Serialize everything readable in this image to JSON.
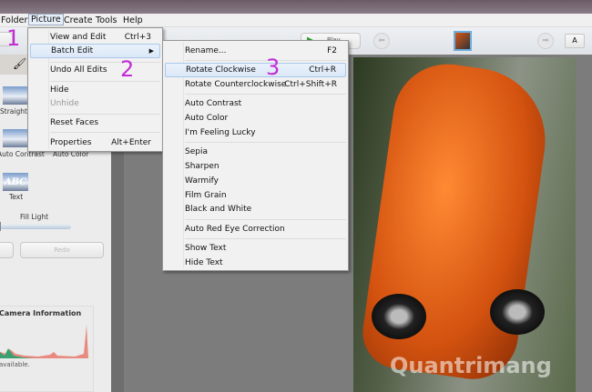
{
  "menubar": {
    "items": [
      "Folder",
      "Picture",
      "Create",
      "Tools",
      "Help"
    ],
    "active": "Picture"
  },
  "picture_menu": [
    {
      "label": "View and Edit",
      "shortcut": "Ctrl+3"
    },
    {
      "label": "Batch Edit",
      "submenu": true
    },
    {
      "label": "Undo All Edits"
    },
    {
      "label": "Hide"
    },
    {
      "label": "Unhide",
      "disabled": true
    },
    {
      "label": "Reset Faces"
    },
    {
      "label": "Properties",
      "shortcut": "Alt+Enter"
    }
  ],
  "batch_menu": [
    {
      "label": "Rename...",
      "shortcut": "F2"
    },
    {
      "label": "Rotate Clockwise",
      "shortcut": "Ctrl+R",
      "highlighted": true
    },
    {
      "label": "Rotate Counterclockwise",
      "shortcut": "Ctrl+Shift+R"
    },
    {
      "label": "Auto Contrast"
    },
    {
      "label": "Auto Color"
    },
    {
      "label": "I'm Feeling Lucky"
    },
    {
      "label": "Sepia"
    },
    {
      "label": "Sharpen"
    },
    {
      "label": "Warmify"
    },
    {
      "label": "Film Grain"
    },
    {
      "label": "Black and White"
    },
    {
      "label": "Auto Red Eye Correction"
    },
    {
      "label": "Show Text"
    },
    {
      "label": "Hide Text"
    }
  ],
  "steps": [
    "1",
    "2",
    "3"
  ],
  "toolbar": {
    "play_label": "Play",
    "text_toggle": "A"
  },
  "left_panel": {
    "straighten": "Straighten",
    "auto_contrast": "Auto Contrast",
    "auto_color": "Auto Color",
    "text": "Text",
    "text_thumb": "ABC",
    "fill_light": "Fill Light",
    "redo": "Redo",
    "camera_info": "Camera Information",
    "unavailable": "available."
  },
  "fill_light_value": 0.0,
  "watermark": "Quantrimang",
  "colors": {
    "accent": "#c42bd8",
    "highlight": "#dbe8f8"
  }
}
